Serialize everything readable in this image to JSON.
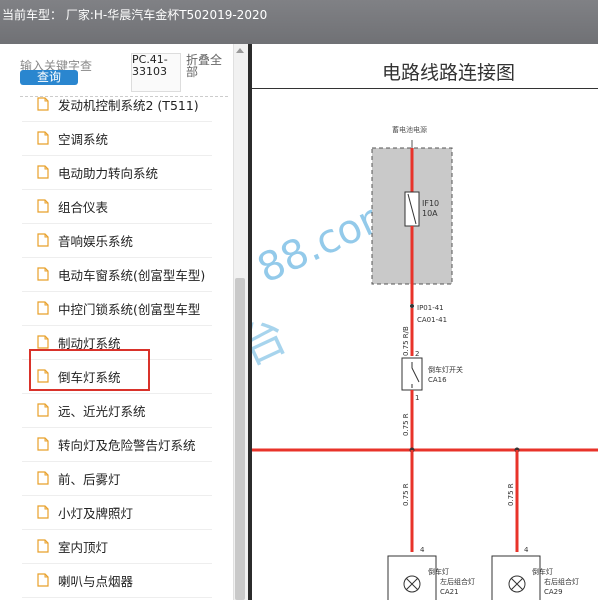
{
  "header": {
    "title": "当前车型： 厂家:H-华晨汽车金杯T502019-2020"
  },
  "search": {
    "placeholder": "输入关键字查",
    "button_label": "查询",
    "pc_code": "PC.41-33103",
    "fold_label": "折叠全部"
  },
  "tree": {
    "items": [
      {
        "label": "发动机控制系统2 (T511)"
      },
      {
        "label": "空调系统"
      },
      {
        "label": "电动助力转向系统"
      },
      {
        "label": "组合仪表"
      },
      {
        "label": "音响娱乐系统"
      },
      {
        "label": "电动车窗系统(创富型车型)"
      },
      {
        "label": "中控门锁系统(创富型车型"
      },
      {
        "label": "制动灯系统"
      },
      {
        "label": "倒车灯系统"
      },
      {
        "label": "远、近光灯系统"
      },
      {
        "label": "转向灯及危险警告灯系统"
      },
      {
        "label": "前、后雾灯"
      },
      {
        "label": "小灯及牌照灯"
      },
      {
        "label": "室内顶灯"
      },
      {
        "label": "喇叭与点烟器"
      }
    ],
    "selected_index": 8
  },
  "diagram": {
    "title": "电路线路连接图",
    "battery_label": "蓄电池电源",
    "fuse_name": "IF10",
    "fuse_rating": "10A",
    "connector_top": "IP01-41",
    "connector_bottom": "CA01-41",
    "wire_top": "0.75 R/B",
    "switch_pin_top": "2",
    "switch_pin_bottom": "1",
    "switch_label": "倒车灯开关",
    "switch_code": "CA16",
    "wire_mid": "0.75 R",
    "wire_left": "0.75 R",
    "wire_right": "0.75 R",
    "lamp_left_pin": "4",
    "lamp_left_label": "左后组合灯",
    "lamp_left_code": "CA21",
    "lamp_left_side_text": "倒车灯",
    "lamp_right_pin": "4",
    "lamp_right_label": "右后组合灯",
    "lamp_right_code": "CA29",
    "lamp_right_side_text": "倒车灯",
    "watermark": "88.com"
  },
  "colors": {
    "wire": "#e8332a",
    "highlight": "#d9322a",
    "button": "#2a86cf",
    "topbar": "#77787c"
  }
}
